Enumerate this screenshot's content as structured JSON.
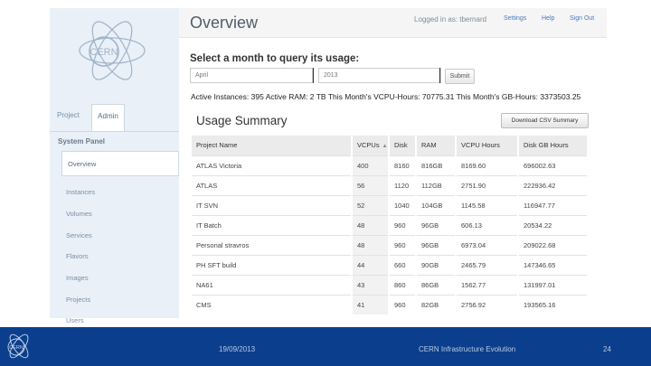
{
  "sidebar": {
    "logo_text": "CERN",
    "tabs": [
      {
        "label": "Project"
      },
      {
        "label": "Admin"
      }
    ],
    "panel_title": "System Panel",
    "items": [
      {
        "label": "Overview"
      },
      {
        "label": "Instances"
      },
      {
        "label": "Volumes"
      },
      {
        "label": "Services"
      },
      {
        "label": "Flavors"
      },
      {
        "label": "Images"
      },
      {
        "label": "Projects"
      },
      {
        "label": "Users"
      }
    ]
  },
  "header": {
    "title": "Overview",
    "logged_in": "Logged in as: tbernard",
    "links": {
      "settings": "Settings",
      "help": "Help",
      "sign_out": "Sign Out"
    }
  },
  "query": {
    "title": "Select a month to query its usage:",
    "month_value": "April",
    "year_value": "2013",
    "submit_label": "Submit"
  },
  "stats_line": "Active Instances: 395 Active RAM: 2 TB This Month's VCPU-Hours: 70775.31 This Month's GB-Hours: 3373503.25",
  "usage": {
    "title": "Usage Summary",
    "csv_label": "Download CSV Summary",
    "columns": [
      "Project Name",
      "VCPUs",
      "Disk",
      "RAM",
      "VCPU Hours",
      "Disk GB Hours"
    ],
    "rows": [
      [
        "ATLAS Victoria",
        "400",
        "8160",
        "816GB",
        "8169.60",
        "696002.63"
      ],
      [
        "ATLAS",
        "56",
        "1120",
        "112GB",
        "2751.90",
        "222936.42"
      ],
      [
        "IT SVN",
        "52",
        "1040",
        "104GB",
        "1145.58",
        "116947.77"
      ],
      [
        "IT Batch",
        "48",
        "960",
        "96GB",
        "606.13",
        "20534.22"
      ],
      [
        "Personal stravros",
        "48",
        "960",
        "96GB",
        "6973.04",
        "209022.68"
      ],
      [
        "PH SFT build",
        "44",
        "660",
        "90GB",
        "2465.79",
        "147346.65"
      ],
      [
        "NA61",
        "43",
        "860",
        "86GB",
        "1562.77",
        "131997.01"
      ],
      [
        "CMS",
        "41",
        "960",
        "82GB",
        "2756.92",
        "193565.16"
      ]
    ]
  },
  "footer": {
    "logo_text": "CERN",
    "date": "19/09/2013",
    "caption": "CERN Infrastructure Evolution",
    "page": "24"
  },
  "colors": {
    "footer_bg": "#0b3f8e",
    "sidebar_bg": "#e9f0f7",
    "link": "#4a7bbd"
  }
}
